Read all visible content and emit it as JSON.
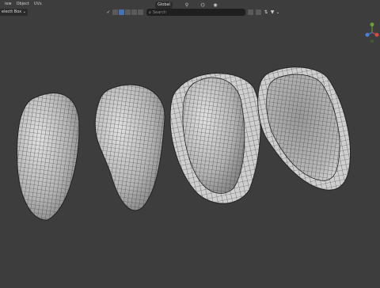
{
  "menu": {
    "view": "iew",
    "object": "Object",
    "uv": "UVs"
  },
  "header": {
    "mode_label": "electt Box",
    "transform_orientation": "Global",
    "search_placeholder": "Search"
  },
  "colors": {
    "viewport_bg": "#3d3d3d",
    "mesh": "#bfbfbf",
    "wire": "#2a2a2a",
    "accent": "#4772b3"
  },
  "icons": [
    "checkmark-icon",
    "select-box-icon",
    "filter-icon",
    "gizmo-axes-icon"
  ]
}
